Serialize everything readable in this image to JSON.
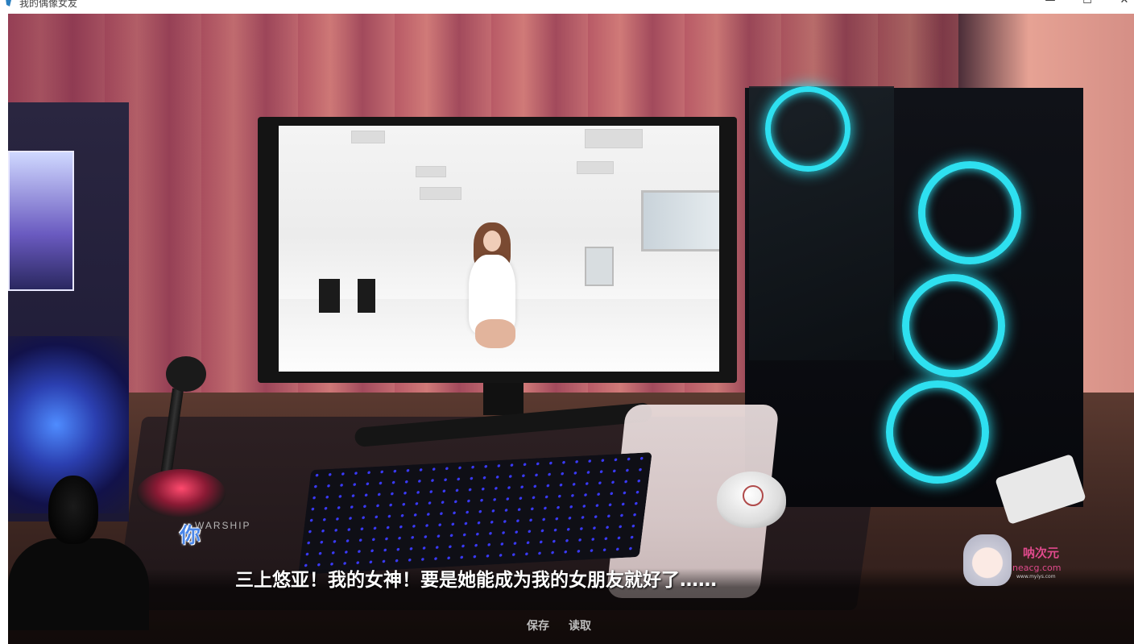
{
  "window": {
    "title": "我的偶像女友",
    "minimize_glyph": "—",
    "maximize_glyph": "☐",
    "close_glyph": "✕"
  },
  "scene": {
    "keyboard_brand": "WARSHIP"
  },
  "dialogue": {
    "speaker": "你",
    "text": "三上悠亚！我的女神！要是她能成为我的女朋友就好了……"
  },
  "menu": {
    "save_label": "保存",
    "load_label": "读取"
  },
  "watermark": {
    "brand": "呐次元",
    "site": "neacg.com",
    "url": "www.myiys.com"
  },
  "colors": {
    "speaker_name": "#4a86e8",
    "dialog_text": "#ffffff",
    "fan_glow": "#2ee0f0",
    "watermark": "#e04a8c"
  }
}
